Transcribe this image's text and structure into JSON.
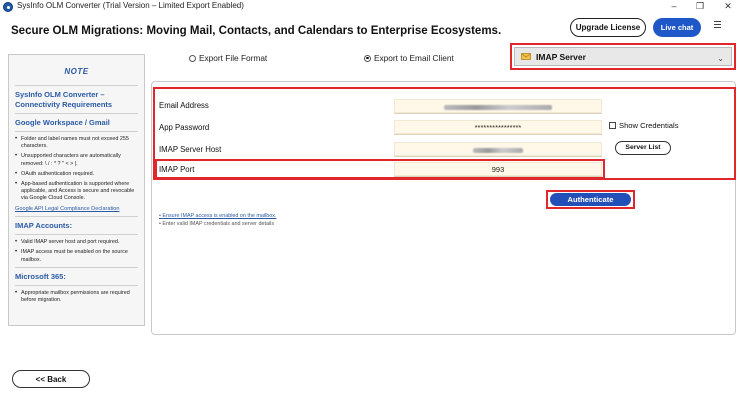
{
  "window": {
    "title": "SysInfo OLM Converter (Trial Version – Limited Export Enabled)",
    "controls": {
      "minimize": "–",
      "restore": "❐",
      "close": "✕"
    }
  },
  "header": {
    "heading": "Secure OLM Migrations: Moving Mail, Contacts, and Calendars to Enterprise Ecosystems.",
    "upgrade_label": "Upgrade License",
    "live_chat_label": "Live chat"
  },
  "note": {
    "title": "NOTE",
    "heading": "SysInfo OLM Converter – Connectivity Requirements",
    "sections": [
      {
        "title": "Google Workspace / Gmail",
        "items": [
          "Folder and label names must not exceed 255 characters.",
          "Unsupported characters are automatically removed: \\ / : * ? \" < > |.",
          "OAuth authentication required.",
          "App-based authentication is supported where applicable, and Access is secure and revocable via Google Cloud Console."
        ],
        "link": "Google API Legal Compliance Declaration"
      },
      {
        "title": "IMAP Accounts:",
        "items": [
          "Valid IMAP server host and port required.",
          "IMAP access must be enabled on the source mailbox."
        ]
      },
      {
        "title": "Microsoft 365:",
        "items": [
          "Appropriate mailbox permissions are required before migration."
        ]
      }
    ]
  },
  "back_label": "<< Back",
  "export_options": {
    "file_format_label": "Export File Format",
    "email_client_label": "Export to Email Client",
    "selected": "email_client"
  },
  "server_select": {
    "selected": "IMAP Server"
  },
  "form": {
    "email_label": "Email Address",
    "password_label": "App Password",
    "password_value": "****************",
    "host_label": "IMAP Server Host",
    "port_label": "IMAP Port",
    "port_value": "993",
    "show_credentials_label": "Show Credentials",
    "server_list_label": "Server List"
  },
  "authenticate_label": "Authenticate",
  "hints": {
    "link": "Ensure IMAP access is enabled on the mailbox.",
    "text": "Enter valid IMAP credentials and server details"
  },
  "colors": {
    "accent_blue": "#234fb8",
    "highlight_red": "#e1262c",
    "note_blue": "#2a5aa5",
    "input_bg": "#fff8e8"
  }
}
